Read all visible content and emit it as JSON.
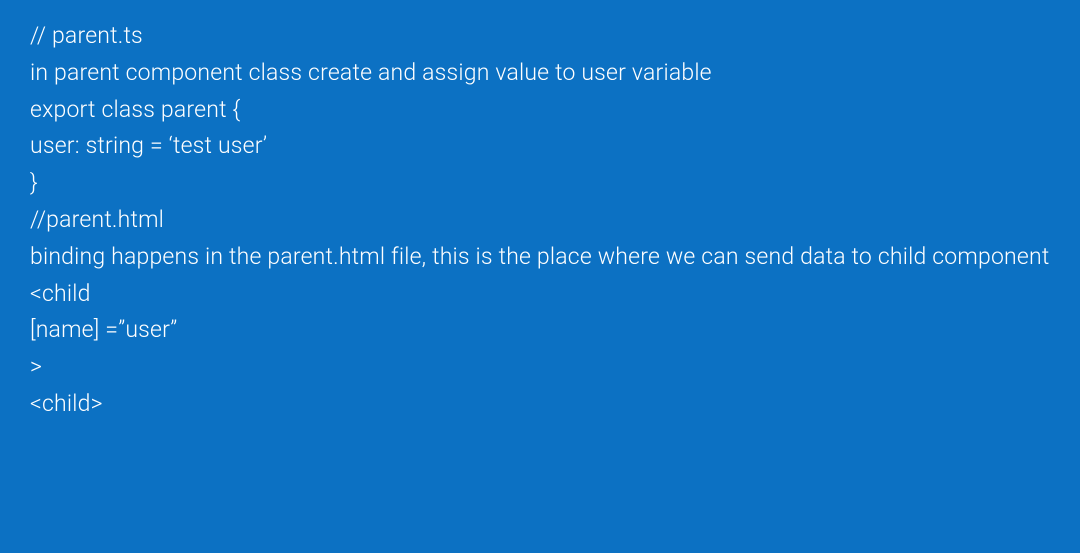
{
  "lines": {
    "l1": "// parent.ts",
    "l2": "in parent component class create and assign value to user variable",
    "l3": "export class parent {",
    "l4": "user: string = ‘test user’",
    "l5": "}",
    "l6": "//parent.html",
    "l7": "binding happens in the parent.html file, this is the place where we can send data to child component",
    "l8": "<child",
    "l9": "[name] =”user”",
    "l10": ">",
    "l11": "<child>"
  }
}
